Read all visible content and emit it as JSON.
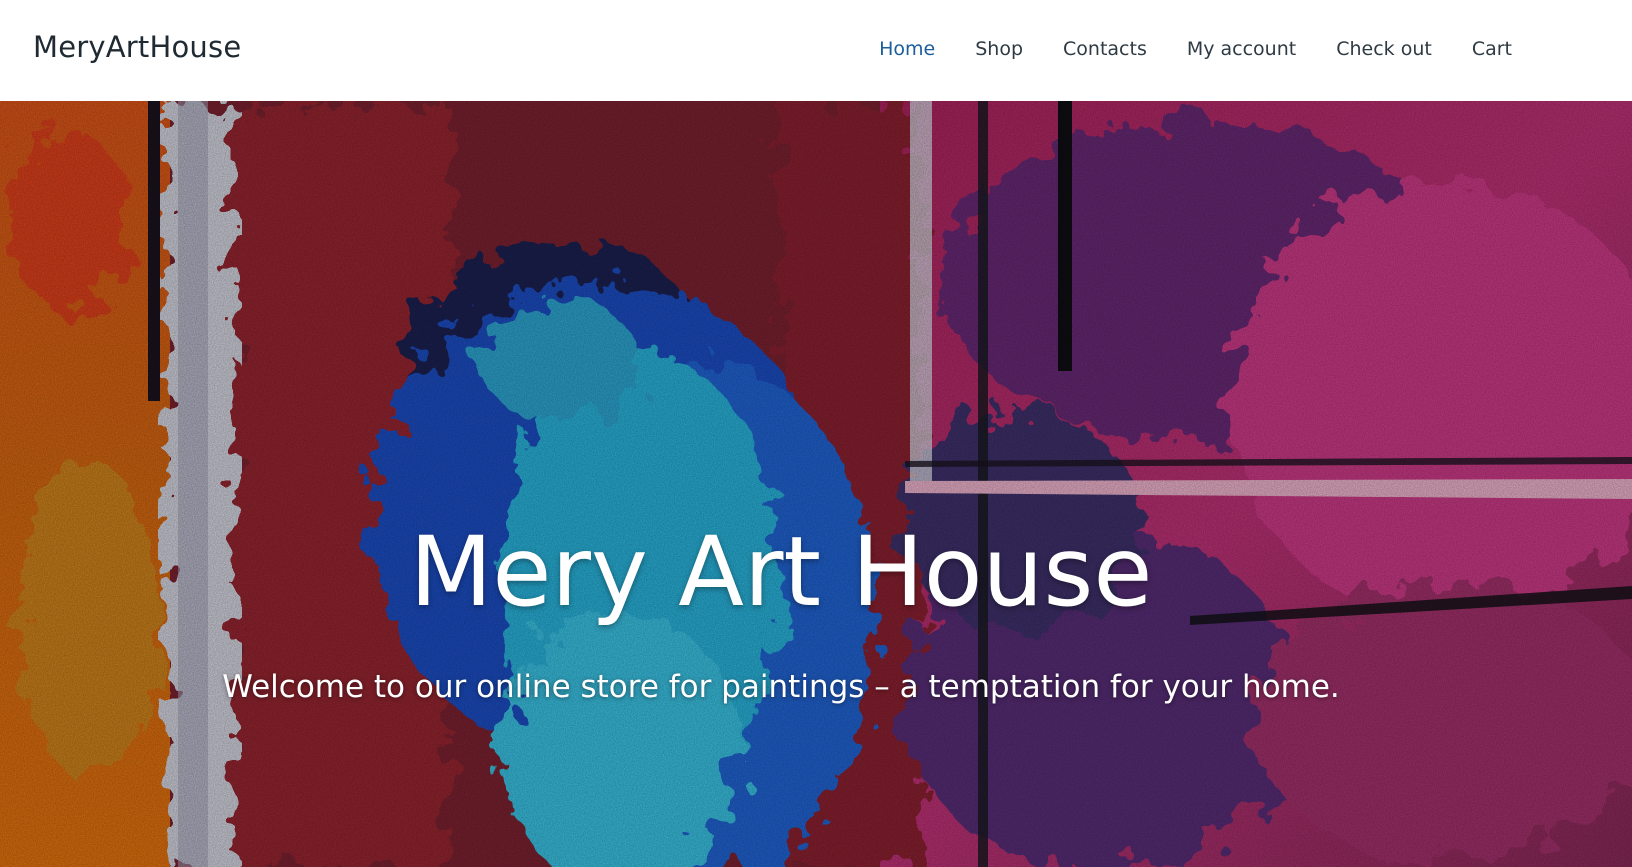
{
  "header": {
    "brand": "MeryArtHouse",
    "nav": [
      {
        "label": "Home",
        "active": true
      },
      {
        "label": "Shop",
        "active": false
      },
      {
        "label": "Contacts",
        "active": false
      },
      {
        "label": "My account",
        "active": false
      },
      {
        "label": "Check out",
        "active": false
      },
      {
        "label": "Cart",
        "active": false
      }
    ]
  },
  "hero": {
    "title": "Mery Art House",
    "subtitle": "Welcome to our online store for paintings – a temptation for your home."
  },
  "colors": {
    "nav_active": "#1b5e9b",
    "nav_text": "#2f3b44",
    "brand_text": "#1f2a33"
  }
}
